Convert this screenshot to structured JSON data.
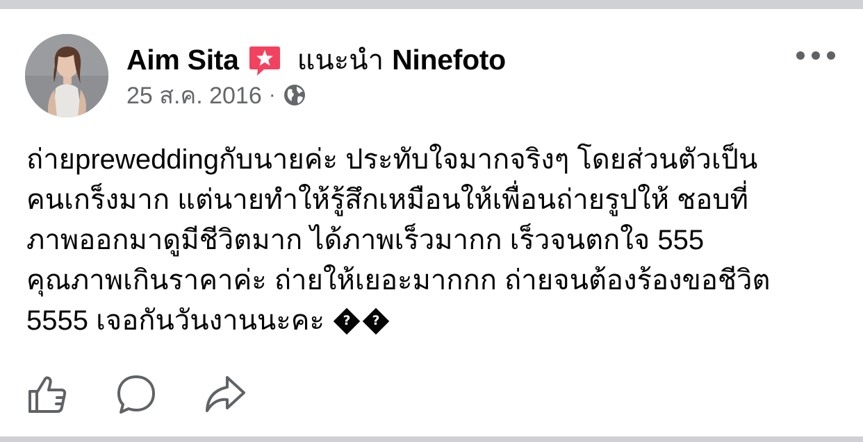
{
  "post": {
    "author_name": "Aim Sita",
    "recommend_text": "แนะนำ",
    "page_name": "Ninefoto",
    "timestamp": "25 ส.ค. 2016",
    "separator": "·",
    "audience_icon": "globe-icon",
    "body_lines": [
      "ถ่ายpreweddingกับนายค่ะ ประทับใจมากจริงๆ โดยส่วนตัวเป็น",
      "คนเกร็งมาก แต่นายทำให้รู้สึกเหมือนให้เพื่อนถ่ายรูปให้ ชอบที่",
      "ภาพออกมาดูมีชีวิตมาก ได้ภาพเร็วมากก เร็วจนตกใจ 555",
      "คุณภาพเกินราคาค่ะ ถ่ายให้เยอะมากกก ถ่ายจนต้องร้องขอชีวิต",
      "5555 เจอกันวันงานนะคะ"
    ],
    "unknown_glyph": "?"
  },
  "icons": {
    "badge": "recommend-star-badge-icon",
    "more": "more-options-icon",
    "like": "like-thumb-icon",
    "comment": "comment-bubble-icon",
    "share": "share-arrow-icon"
  },
  "colors": {
    "badge": "#f3425f",
    "secondary_text": "#65676b",
    "text": "#050505",
    "background": "#d0d1d5",
    "card": "#ffffff"
  }
}
